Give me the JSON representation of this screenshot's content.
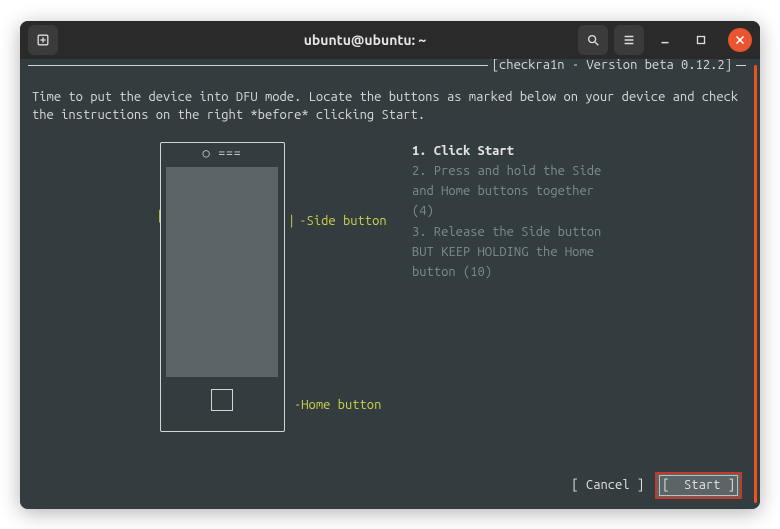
{
  "window": {
    "title": "ubuntu@ubuntu: ~"
  },
  "app": {
    "frame_title": "[checkra1n - Version beta 0.12.2]",
    "intro": "Time to put the device into DFU mode. Locate the buttons as marked below on your device and check the instructions on the right *before* clicking Start.",
    "labels": {
      "side_button": "-Side button",
      "home_button": "-Home button"
    },
    "steps": {
      "s1": "1. Click Start",
      "s2a": "2. Press and hold the Side",
      "s2b": "   and Home buttons together",
      "s2c": "   (4)",
      "s3a": "3. Release the Side button",
      "s3b": "   BUT KEEP HOLDING the Home",
      "s3c": "   button (10)"
    },
    "buttons": {
      "cancel": "[ Cancel ]",
      "start": "[  Start ]"
    }
  }
}
